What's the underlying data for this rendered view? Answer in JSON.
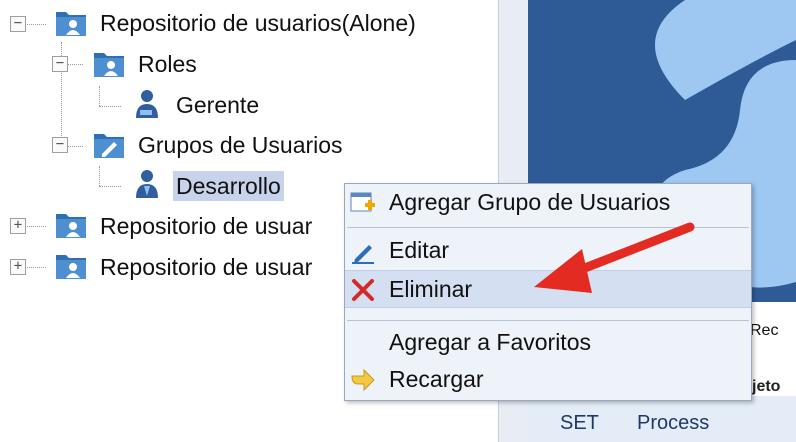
{
  "tree": {
    "nodes": [
      {
        "label": "Repositorio de usuarios(Alone)",
        "toggle": "−",
        "icon": "repository-folder-icon"
      },
      {
        "label": "Roles",
        "toggle": "−",
        "icon": "roles-folder-icon"
      },
      {
        "label": "Gerente",
        "icon": "user-role-icon"
      },
      {
        "label": "Grupos de Usuarios",
        "toggle": "−",
        "icon": "groups-folder-icon"
      },
      {
        "label": "Desarrollo",
        "icon": "user-group-icon"
      },
      {
        "label": "Repositorio de usuar",
        "toggle": "+",
        "icon": "repository-folder-icon"
      },
      {
        "label": "Repositorio de usuar",
        "toggle": "+",
        "icon": "repository-folder-icon"
      }
    ]
  },
  "context_menu": {
    "items": [
      {
        "label": "Agregar Grupo de Usuarios",
        "icon": "add-group-icon"
      },
      {
        "label": "Editar",
        "icon": "pencil-icon"
      },
      {
        "label": "Eliminar",
        "icon": "delete-x-icon"
      },
      {
        "label": "Agregar a Favoritos",
        "icon": ""
      },
      {
        "label": "Recargar",
        "icon": "refresh-arrow-icon"
      }
    ]
  },
  "right_panel": {
    "heading_fragment": "Rec",
    "sub_fragment": "jeto",
    "tabs": [
      "SET",
      "Process"
    ]
  },
  "colors": {
    "banner": "#2e5b95",
    "menu_bg": "#eef2f9",
    "menu_hover": "#d4dff1",
    "selection": "#c7d3ea",
    "arrow": "#e32b22"
  }
}
